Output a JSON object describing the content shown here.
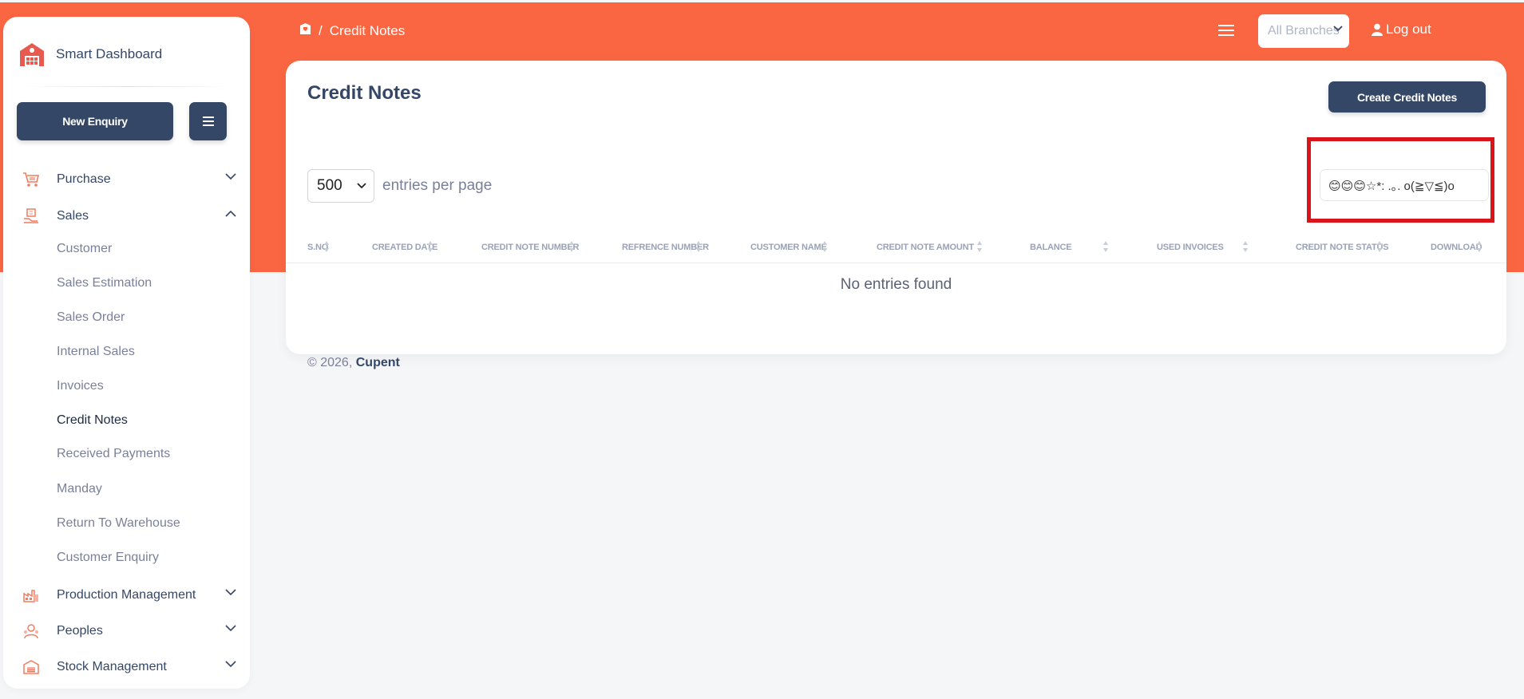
{
  "brand": {
    "name": "Smart Dashboard"
  },
  "sidebar": {
    "new_enquiry_label": "New Enquiry",
    "items": [
      {
        "label": "Purchase",
        "icon": "cart-icon",
        "expanded": false
      },
      {
        "label": "Sales",
        "icon": "sales-icon",
        "expanded": true
      },
      {
        "label": "Production Management",
        "icon": "factory-icon",
        "expanded": false
      },
      {
        "label": "Peoples",
        "icon": "people-icon",
        "expanded": false
      },
      {
        "label": "Stock Management",
        "icon": "warehouse-icon",
        "expanded": false
      }
    ],
    "sales_sub": [
      "Customer",
      "Sales Estimation",
      "Sales Order",
      "Internal Sales",
      "Invoices",
      "Credit Notes",
      "Received Payments",
      "Manday",
      "Return To Warehouse",
      "Customer Enquiry"
    ],
    "active_sub": "Credit Notes"
  },
  "header": {
    "breadcrumb_separator": "/",
    "breadcrumb_current": "Credit Notes",
    "branch_placeholder": "All Branches",
    "logout_label": "Log out"
  },
  "card": {
    "title": "Credit Notes",
    "create_button": "Create Credit Notes",
    "entries_value": "500",
    "entries_label": "entries per page",
    "search_value": "😊😊😊☆*: .｡. o(≧▽≦)o",
    "columns": [
      "S.NO",
      "CREATED DATE",
      "CREDIT NOTE NUMBER",
      "REFRENCE NUMBER",
      "CUSTOMER NAME",
      "CREDIT NOTE AMOUNT",
      "BALANCE",
      "USED INVOICES",
      "CREDIT NOTE STATUS",
      "DOWNLOAD"
    ],
    "empty_message": "No entries found"
  },
  "footer": {
    "copyright": "© 2026,",
    "company": "Cupent"
  },
  "colors": {
    "accent": "#fb6642",
    "primary": "#344767",
    "highlight": "#d9141a"
  }
}
